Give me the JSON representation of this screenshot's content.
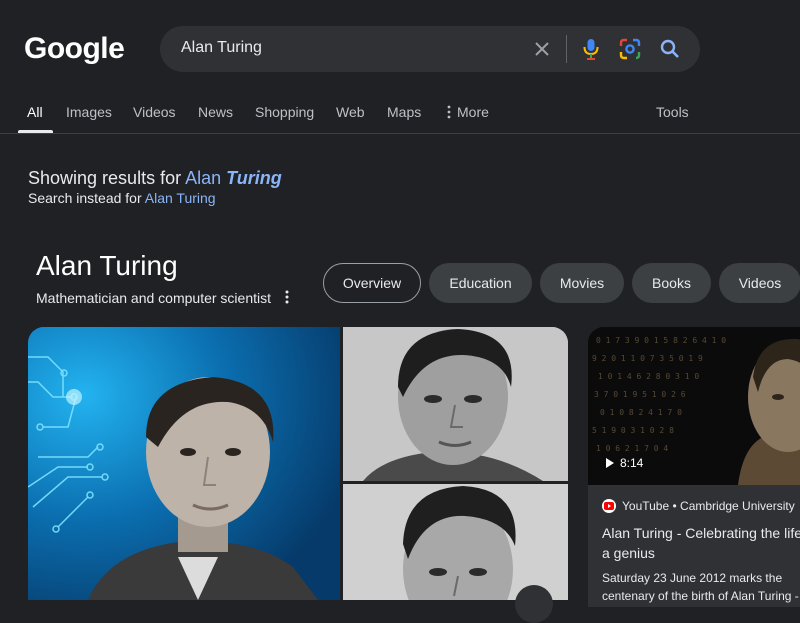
{
  "header": {
    "logo": "Google",
    "search": {
      "query": "Alan Turing",
      "icons": [
        "close-icon",
        "microphone-icon",
        "lens-icon",
        "search-icon"
      ]
    }
  },
  "tabs": [
    {
      "label": "All",
      "active": true
    },
    {
      "label": "Images"
    },
    {
      "label": "Videos"
    },
    {
      "label": "News"
    },
    {
      "label": "Shopping"
    },
    {
      "label": "Web"
    },
    {
      "label": "Maps"
    },
    {
      "label": "More"
    }
  ],
  "tools_label": "Tools",
  "correction": {
    "prefix": "Showing results for ",
    "term_a": "Alan",
    "term_b": "Turing",
    "instead_prefix": "Search instead for ",
    "instead_term": "Alan Turing"
  },
  "knowledge_panel": {
    "title": "Alan Turing",
    "subtitle": "Mathematician and computer scientist",
    "chips": [
      "Overview",
      "Education",
      "Movies",
      "Books",
      "Videos"
    ]
  },
  "video": {
    "duration": "8:14",
    "source": "YouTube • Cambridge University",
    "title": "Alan Turing - Celebrating the life of a genius",
    "description": "Saturday 23 June 2012 marks the centenary of the birth of Alan Turing -"
  },
  "colors": {
    "background": "#202124",
    "link": "#8ab4f8",
    "chip": "#3c4043",
    "search_bg": "#303134"
  }
}
